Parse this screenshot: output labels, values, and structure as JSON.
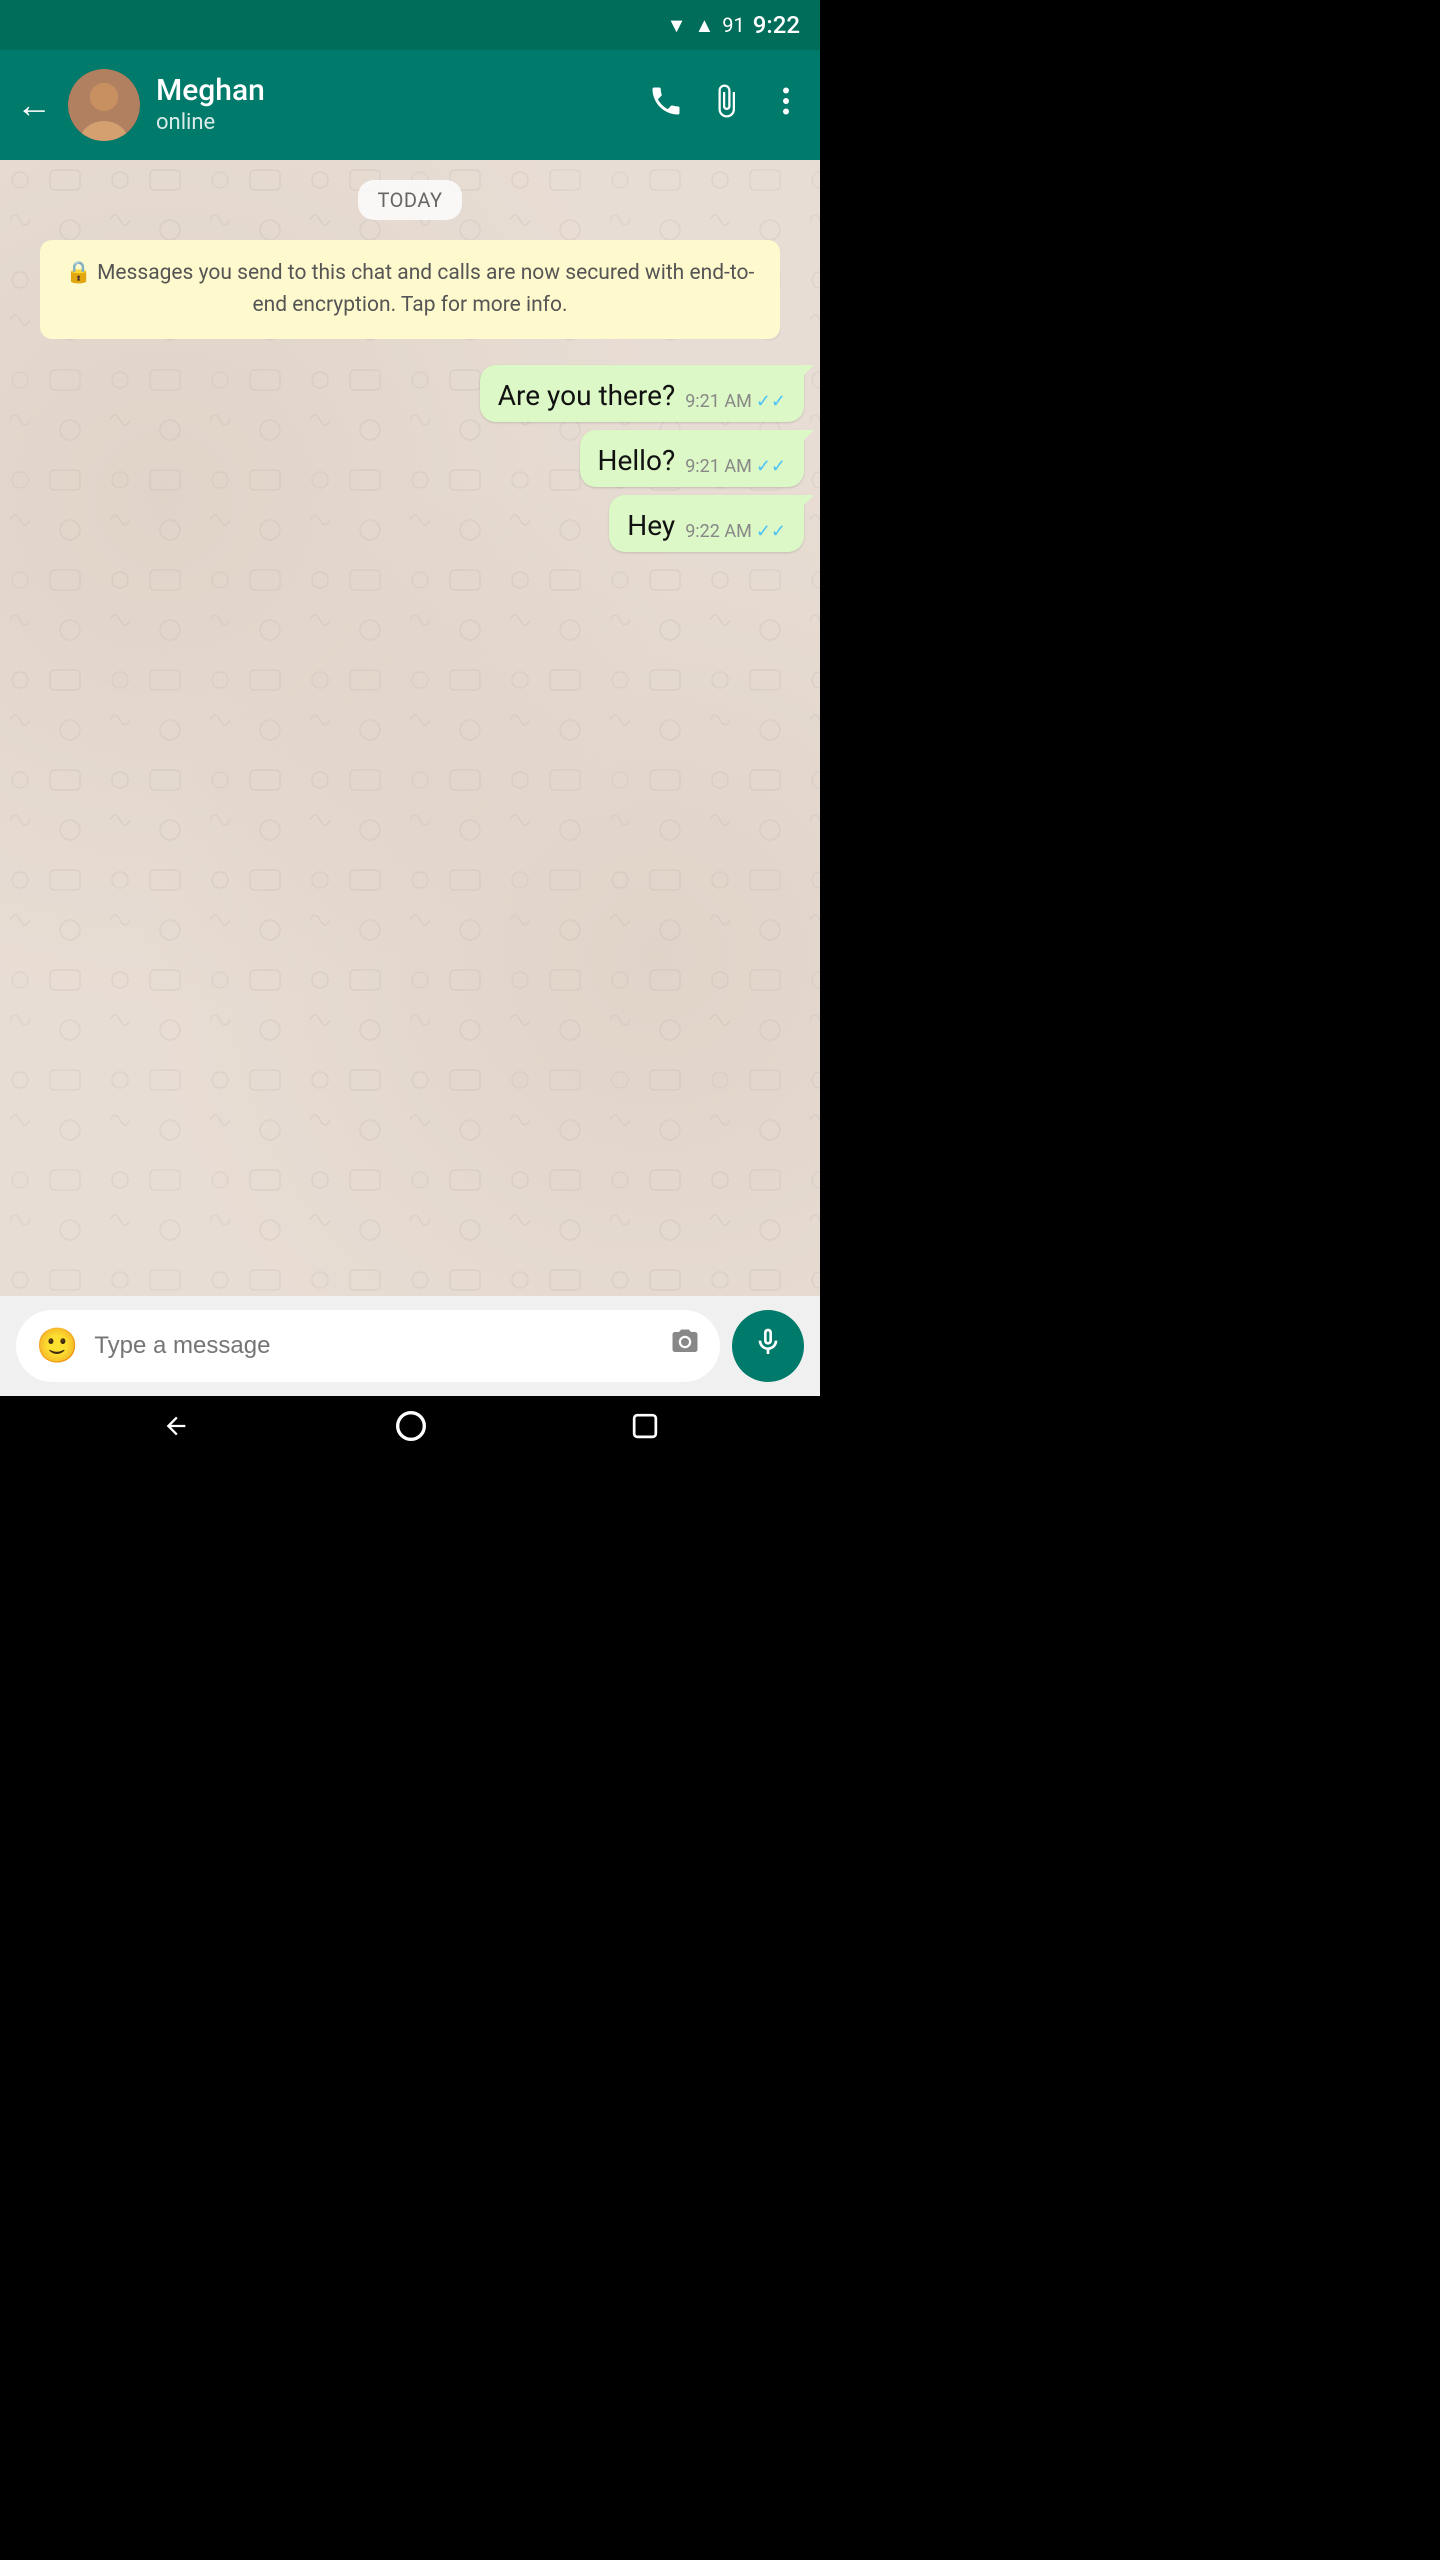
{
  "statusBar": {
    "time": "9:22",
    "battery": "91"
  },
  "toolbar": {
    "contactName": "Meghan",
    "contactStatus": "online",
    "backLabel": "←",
    "callIcon": "call",
    "attachIcon": "attach",
    "moreIcon": "more"
  },
  "chat": {
    "dateBadge": "TODAY",
    "encryptionNotice": "🔒 Messages you send to this chat and calls are now secured with end-to-end encryption. Tap for more info.",
    "messages": [
      {
        "text": "Are you there?",
        "time": "9:21 AM",
        "ticks": "✓✓"
      },
      {
        "text": "Hello?",
        "time": "9:21 AM",
        "ticks": "✓✓"
      },
      {
        "text": "Hey",
        "time": "9:22 AM",
        "ticks": "✓✓"
      }
    ]
  },
  "inputBar": {
    "placeholder": "Type a message"
  },
  "bottomNav": {
    "back": "◀",
    "home": "○",
    "recent": "□"
  }
}
